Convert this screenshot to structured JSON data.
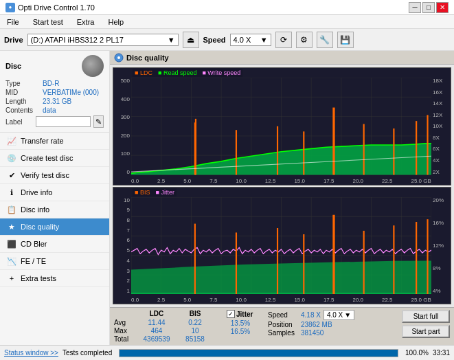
{
  "titlebar": {
    "icon": "●",
    "title": "Opti Drive Control 1.70",
    "min": "─",
    "max": "□",
    "close": "✕"
  },
  "menubar": {
    "items": [
      "File",
      "Start test",
      "Extra",
      "Help"
    ]
  },
  "drivebar": {
    "label": "Drive",
    "drive_value": "(D:) ATAPI iHBS312  2 PL17",
    "speed_label": "Speed",
    "speed_value": "4.0 X",
    "dropdown_arrow": "▼"
  },
  "sidebar": {
    "disc_title": "Disc",
    "type_label": "Type",
    "type_value": "BD-R",
    "mid_label": "MID",
    "mid_value": "VERBATIMe (000)",
    "length_label": "Length",
    "length_value": "23.31 GB",
    "contents_label": "Contents",
    "contents_value": "data",
    "label_label": "Label",
    "label_input": "",
    "nav_items": [
      {
        "id": "transfer-rate",
        "label": "Transfer rate",
        "icon": "📈"
      },
      {
        "id": "create-test-disc",
        "label": "Create test disc",
        "icon": "💿"
      },
      {
        "id": "verify-test-disc",
        "label": "Verify test disc",
        "icon": "✔"
      },
      {
        "id": "drive-info",
        "label": "Drive info",
        "icon": "ℹ"
      },
      {
        "id": "disc-info",
        "label": "Disc info",
        "icon": "📋"
      },
      {
        "id": "disc-quality",
        "label": "Disc quality",
        "icon": "★",
        "active": true
      },
      {
        "id": "cd-bler",
        "label": "CD Bler",
        "icon": "⬛"
      },
      {
        "id": "fe-te",
        "label": "FE / TE",
        "icon": "📉"
      },
      {
        "id": "extra-tests",
        "label": "Extra tests",
        "icon": "+"
      }
    ]
  },
  "disc_quality": {
    "title": "Disc quality",
    "chart1": {
      "legend": [
        {
          "label": "LDC",
          "color": "#ff6600"
        },
        {
          "label": "Read speed",
          "color": "#00ff00"
        },
        {
          "label": "Write speed",
          "color": "#ff00ff"
        }
      ],
      "y_labels_left": [
        "500",
        "400",
        "300",
        "200",
        "100",
        "0"
      ],
      "y_labels_right": [
        "18X",
        "16X",
        "14X",
        "12X",
        "10X",
        "8X",
        "6X",
        "4X",
        "2X"
      ],
      "x_labels": [
        "0.0",
        "2.5",
        "5.0",
        "7.5",
        "10.0",
        "12.5",
        "15.0",
        "17.5",
        "20.0",
        "22.5",
        "25.0 GB"
      ]
    },
    "chart2": {
      "legend": [
        {
          "label": "BIS",
          "color": "#ff6600"
        },
        {
          "label": "Jitter",
          "color": "#ff88ff"
        }
      ],
      "y_labels_left": [
        "10",
        "9",
        "8",
        "7",
        "6",
        "5",
        "4",
        "3",
        "2",
        "1"
      ],
      "y_labels_right": [
        "20%",
        "16%",
        "12%",
        "8%",
        "4%"
      ],
      "x_labels": [
        "0.0",
        "2.5",
        "5.0",
        "7.5",
        "10.0",
        "12.5",
        "15.0",
        "17.5",
        "20.0",
        "22.5",
        "25.0 GB"
      ]
    }
  },
  "stats": {
    "col_headers": [
      "LDC",
      "BIS"
    ],
    "jitter_header": "Jitter",
    "rows": [
      {
        "label": "Avg",
        "ldc": "11.44",
        "bis": "0.22",
        "jitter": "13.5%"
      },
      {
        "label": "Max",
        "ldc": "464",
        "bis": "10",
        "jitter": "16.5%"
      },
      {
        "label": "Total",
        "ldc": "4369539",
        "bis": "85158",
        "jitter": ""
      }
    ],
    "speed_label": "Speed",
    "speed_value": "4.18 X",
    "speed_select": "4.0 X",
    "position_label": "Position",
    "position_value": "23862 MB",
    "samples_label": "Samples",
    "samples_value": "381450",
    "start_full_btn": "Start full",
    "start_part_btn": "Start part"
  },
  "statusbar": {
    "status_link": "Status window >>",
    "status_text": "Tests completed",
    "progress": "100.0%",
    "time": "33:31"
  }
}
